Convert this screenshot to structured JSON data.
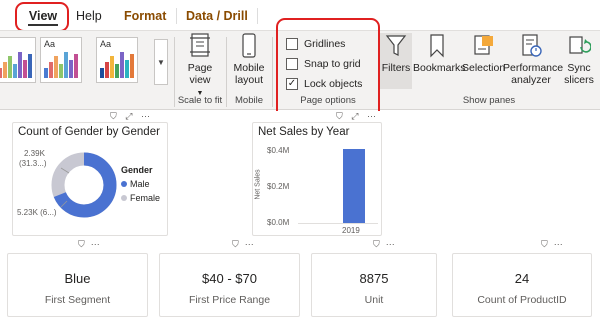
{
  "tabs": {
    "view": "View",
    "help": "Help",
    "format": "Format",
    "data_drill": "Data / Drill"
  },
  "ribbon": {
    "themes": [
      {
        "label": "Aa",
        "colors": [
          "#e06b6b",
          "#f0a35e",
          "#8fc66a",
          "#5aa4d6",
          "#7c64c6",
          "#c24f93",
          "#3a66b8"
        ]
      },
      {
        "label": "Aa",
        "colors": [
          "#4a7bd1",
          "#e06b6b",
          "#f0a35e",
          "#8fc66a",
          "#5aa4d6",
          "#7c64c6",
          "#c24f93"
        ]
      },
      {
        "label": "Aa",
        "colors": [
          "#1f4e9c",
          "#d64545",
          "#f2b53c",
          "#46a25b",
          "#7c64c6",
          "#2bb3c0",
          "#e3793a"
        ]
      }
    ],
    "scale_to_fit": {
      "button": "Page view",
      "group": "Scale to fit"
    },
    "mobile": {
      "button": "Mobile layout",
      "group": "Mobile"
    },
    "page_options": {
      "group": "Page options",
      "gridlines": {
        "label": "Gridlines",
        "checked": false
      },
      "snap_to_grid": {
        "label": "Snap to grid",
        "checked": false
      },
      "lock_objects": {
        "label": "Lock objects",
        "checked": true
      }
    },
    "show_panes": {
      "group": "Show panes",
      "buttons": [
        "Filters",
        "Bookmarks",
        "Selection",
        "Performance analyzer",
        "Sync slicers"
      ]
    }
  },
  "canvas": {
    "donut": {
      "title": "Count of Gender by Gender",
      "legend_title": "Gender",
      "legend": [
        {
          "label": "Male",
          "color": "#4a72d1"
        },
        {
          "label": "Female",
          "color": "#c8c8d2"
        }
      ],
      "label_top": "2.39K",
      "label_top_sub": "(31.3...)",
      "label_bottom": "5.23K (6...)"
    },
    "bar": {
      "title": "Net Sales by Year",
      "ylabel": "Net Sales",
      "yticks": [
        "$0.4M",
        "$0.2M",
        "$0.0M"
      ],
      "category": "2019"
    },
    "kpis": [
      {
        "value": "Blue",
        "label": "First Segment"
      },
      {
        "value": "$40 - $70",
        "label": "First Price Range"
      },
      {
        "value": "8875",
        "label": "Unit"
      },
      {
        "value": "24",
        "label": "Count of ProductID"
      }
    ],
    "accent": "#4a72d1"
  }
}
